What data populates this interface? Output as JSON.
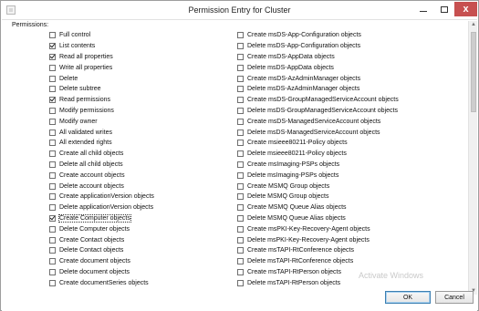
{
  "window": {
    "title": "Permission Entry for Cluster",
    "icon": "app-icon",
    "controls": {
      "minimize": "–",
      "maximize": "□",
      "close": "x"
    }
  },
  "section_label": "Permissions:",
  "permissions_left": [
    {
      "label": "Full control",
      "checked": false
    },
    {
      "label": "List contents",
      "checked": true
    },
    {
      "label": "Read all properties",
      "checked": true
    },
    {
      "label": "Write all properties",
      "checked": false
    },
    {
      "label": "Delete",
      "checked": false
    },
    {
      "label": "Delete subtree",
      "checked": false
    },
    {
      "label": "Read permissions",
      "checked": true
    },
    {
      "label": "Modify permissions",
      "checked": false
    },
    {
      "label": "Modify owner",
      "checked": false
    },
    {
      "label": "All validated writes",
      "checked": false
    },
    {
      "label": "All extended rights",
      "checked": false
    },
    {
      "label": "Create all child objects",
      "checked": false
    },
    {
      "label": "Delete all child objects",
      "checked": false
    },
    {
      "label": "Create account objects",
      "checked": false
    },
    {
      "label": "Delete account objects",
      "checked": false
    },
    {
      "label": "Create applicationVersion objects",
      "checked": false
    },
    {
      "label": "Delete applicationVersion objects",
      "checked": false
    },
    {
      "label": "Create Computer objects",
      "checked": true,
      "focused": true
    },
    {
      "label": "Delete Computer objects",
      "checked": false
    },
    {
      "label": "Create Contact objects",
      "checked": false
    },
    {
      "label": "Delete Contact objects",
      "checked": false
    },
    {
      "label": "Create document objects",
      "checked": false
    },
    {
      "label": "Delete document objects",
      "checked": false
    },
    {
      "label": "Create documentSeries objects",
      "checked": false
    }
  ],
  "permissions_right": [
    {
      "label": "Create msDS-App-Configuration objects",
      "checked": false
    },
    {
      "label": "Delete msDS-App-Configuration objects",
      "checked": false
    },
    {
      "label": "Create msDS-AppData objects",
      "checked": false
    },
    {
      "label": "Delete msDS-AppData objects",
      "checked": false
    },
    {
      "label": "Create msDS-AzAdminManager objects",
      "checked": false
    },
    {
      "label": "Delete msDS-AzAdminManager objects",
      "checked": false
    },
    {
      "label": "Create msDS-GroupManagedServiceAccount objects",
      "checked": false
    },
    {
      "label": "Delete msDS-GroupManagedServiceAccount objects",
      "checked": false
    },
    {
      "label": "Create msDS-ManagedServiceAccount objects",
      "checked": false
    },
    {
      "label": "Delete msDS-ManagedServiceAccount objects",
      "checked": false
    },
    {
      "label": "Create msieee80211-Policy objects",
      "checked": false
    },
    {
      "label": "Delete msieee80211-Policy objects",
      "checked": false
    },
    {
      "label": "Create msImaging-PSPs objects",
      "checked": false
    },
    {
      "label": "Delete msImaging-PSPs objects",
      "checked": false
    },
    {
      "label": "Create MSMQ Group objects",
      "checked": false
    },
    {
      "label": "Delete MSMQ Group objects",
      "checked": false
    },
    {
      "label": "Create MSMQ Queue Alias objects",
      "checked": false
    },
    {
      "label": "Delete MSMQ Queue Alias objects",
      "checked": false
    },
    {
      "label": "Create msPKI-Key-Recovery-Agent objects",
      "checked": false
    },
    {
      "label": "Delete msPKI-Key-Recovery-Agent objects",
      "checked": false
    },
    {
      "label": "Create msTAPI-RtConference objects",
      "checked": false
    },
    {
      "label": "Delete msTAPI-RtConference objects",
      "checked": false
    },
    {
      "label": "Create msTAPI-RtPerson objects",
      "checked": false
    },
    {
      "label": "Delete msTAPI-RtPerson objects",
      "checked": false
    }
  ],
  "buttons": {
    "ok": "OK",
    "cancel": "Cancel"
  },
  "watermark": "Activate Windows",
  "colors": {
    "close_button": "#c75050",
    "default_button_border": "#3c7fb1"
  }
}
